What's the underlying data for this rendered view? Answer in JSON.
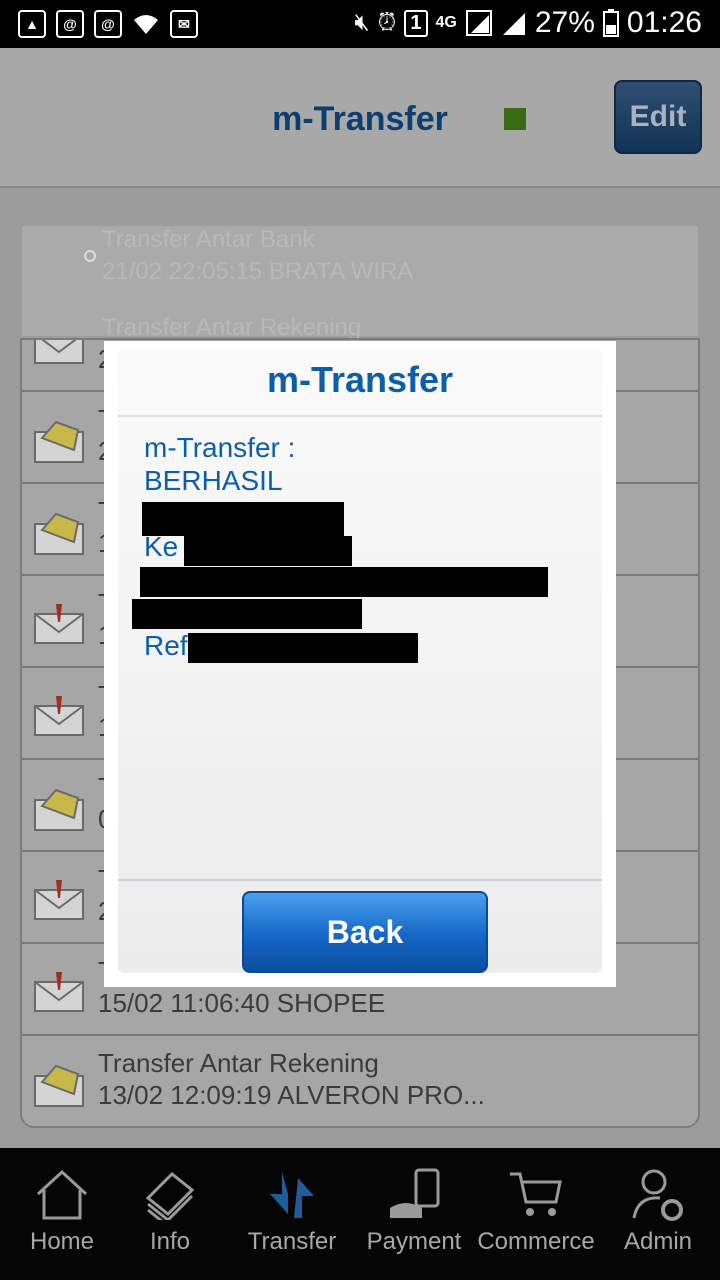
{
  "status_bar": {
    "battery": "27%",
    "time": "01:26",
    "network": "4G",
    "sim": "1"
  },
  "header": {
    "title": "m-Transfer",
    "edit_label": "Edit"
  },
  "list": {
    "ghost_rows": [
      {
        "title": "Transfer Antar Bank",
        "sub": "21/02 22:05:15 BRATA WIRA"
      },
      {
        "title": "Transfer Antar Rekening"
      }
    ],
    "rows": [
      {
        "icon": "error-envelope-icon",
        "title": "T",
        "sub": "2"
      },
      {
        "icon": "open-envelope-icon",
        "title": "T",
        "sub": "2"
      },
      {
        "icon": "open-envelope-icon",
        "title": "T",
        "sub": "1"
      },
      {
        "icon": "error-envelope-icon",
        "title": "T",
        "sub": "1"
      },
      {
        "icon": "error-envelope-icon",
        "title": "T",
        "sub": "1"
      },
      {
        "icon": "open-envelope-icon",
        "title": "T",
        "sub": "0"
      },
      {
        "icon": "error-envelope-icon",
        "title": "T",
        "sub": "2"
      },
      {
        "icon": "error-envelope-icon",
        "title": "T",
        "sub": "15/02 11:06:40 SHOPEE"
      },
      {
        "icon": "open-envelope-icon",
        "title": "Transfer Antar Rekening",
        "sub": "13/02 12:09:19 ALVERON PRO..."
      }
    ]
  },
  "modal": {
    "title": "m-Transfer",
    "line1": "m-Transfer :",
    "line2": "BERHASIL",
    "ke_label": "Ke",
    "ref_label": "Ref",
    "back_label": "Back"
  },
  "nav": {
    "items": [
      {
        "label": "Home",
        "icon": "home-icon"
      },
      {
        "label": "Info",
        "icon": "info-icon"
      },
      {
        "label": "Transfer",
        "icon": "transfer-icon"
      },
      {
        "label": "Payment",
        "icon": "payment-icon"
      },
      {
        "label": "Commerce",
        "icon": "cart-icon"
      },
      {
        "label": "Admin",
        "icon": "admin-icon"
      }
    ]
  }
}
